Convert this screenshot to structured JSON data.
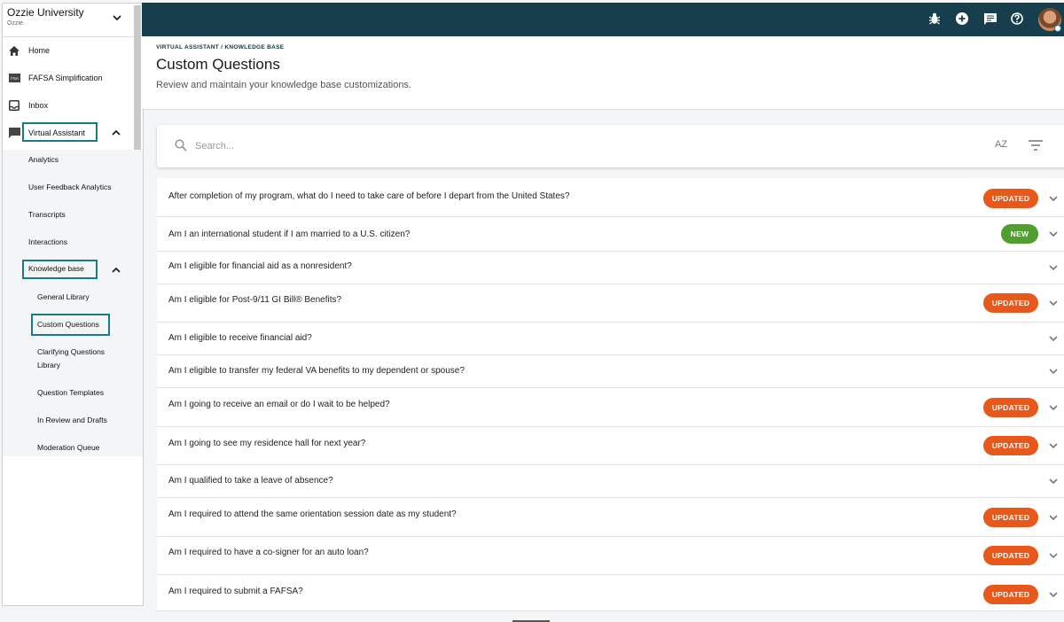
{
  "org": {
    "name": "Ozzie University",
    "sub": "Ozzie"
  },
  "nav": {
    "home": "Home",
    "fafsa": "FAFSA Simplification",
    "inbox": "Inbox",
    "virtual_assistant": "Virtual Assistant",
    "analytics": "Analytics",
    "user_feedback_analytics": "User Feedback Analytics",
    "transcripts": "Transcripts",
    "interactions": "Interactions",
    "knowledge_base": "Knowledge base",
    "general_library": "General Library",
    "custom_questions": "Custom Questions",
    "clarifying_questions_library": "Clarifying Questions Library",
    "question_templates": "Question Templates",
    "in_review_and_drafts": "In Review and Drafts",
    "moderation_queue": "Moderation Queue"
  },
  "header": {
    "breadcrumb": "VIRTUAL ASSISTANT  /  KNOWLEDGE BASE",
    "title": "Custom Questions",
    "subtitle": "Review and maintain your knowledge base customizations."
  },
  "search": {
    "placeholder": "Search...",
    "sort_label": "AZ"
  },
  "questions": [
    {
      "text": "After completion of my program, what do I need to take care of before I depart from the United States?",
      "badge": "UPDATED"
    },
    {
      "text": "Am I an international student if I am married to a U.S. citizen?",
      "badge": "NEW"
    },
    {
      "text": "Am I eligible for financial aid as a nonresident?",
      "badge": ""
    },
    {
      "text": "Am I eligible for Post-9/11 GI Bill® Benefits?",
      "badge": "UPDATED"
    },
    {
      "text": "Am I eligible to receive financial aid?",
      "badge": ""
    },
    {
      "text": "Am I eligible to transfer my federal VA benefits to my dependent or spouse?",
      "badge": ""
    },
    {
      "text": "Am I going to receive an email or do I wait to be helped?",
      "badge": "UPDATED"
    },
    {
      "text": "Am I going to see my residence hall for next year?",
      "badge": "UPDATED"
    },
    {
      "text": "Am I qualified to take a leave of absence?",
      "badge": ""
    },
    {
      "text": "Am I required to attend the same orientation session date as my student?",
      "badge": "UPDATED"
    },
    {
      "text": "Am I required to have a co-signer for an auto loan?",
      "badge": "UPDATED"
    },
    {
      "text": "Am I required to submit a FAFSA?",
      "badge": "UPDATED"
    }
  ],
  "colors": {
    "topbar": "#173e4c",
    "highlight": "#1a7a86",
    "updated": "#e8581a",
    "new": "#4f9e2e"
  }
}
